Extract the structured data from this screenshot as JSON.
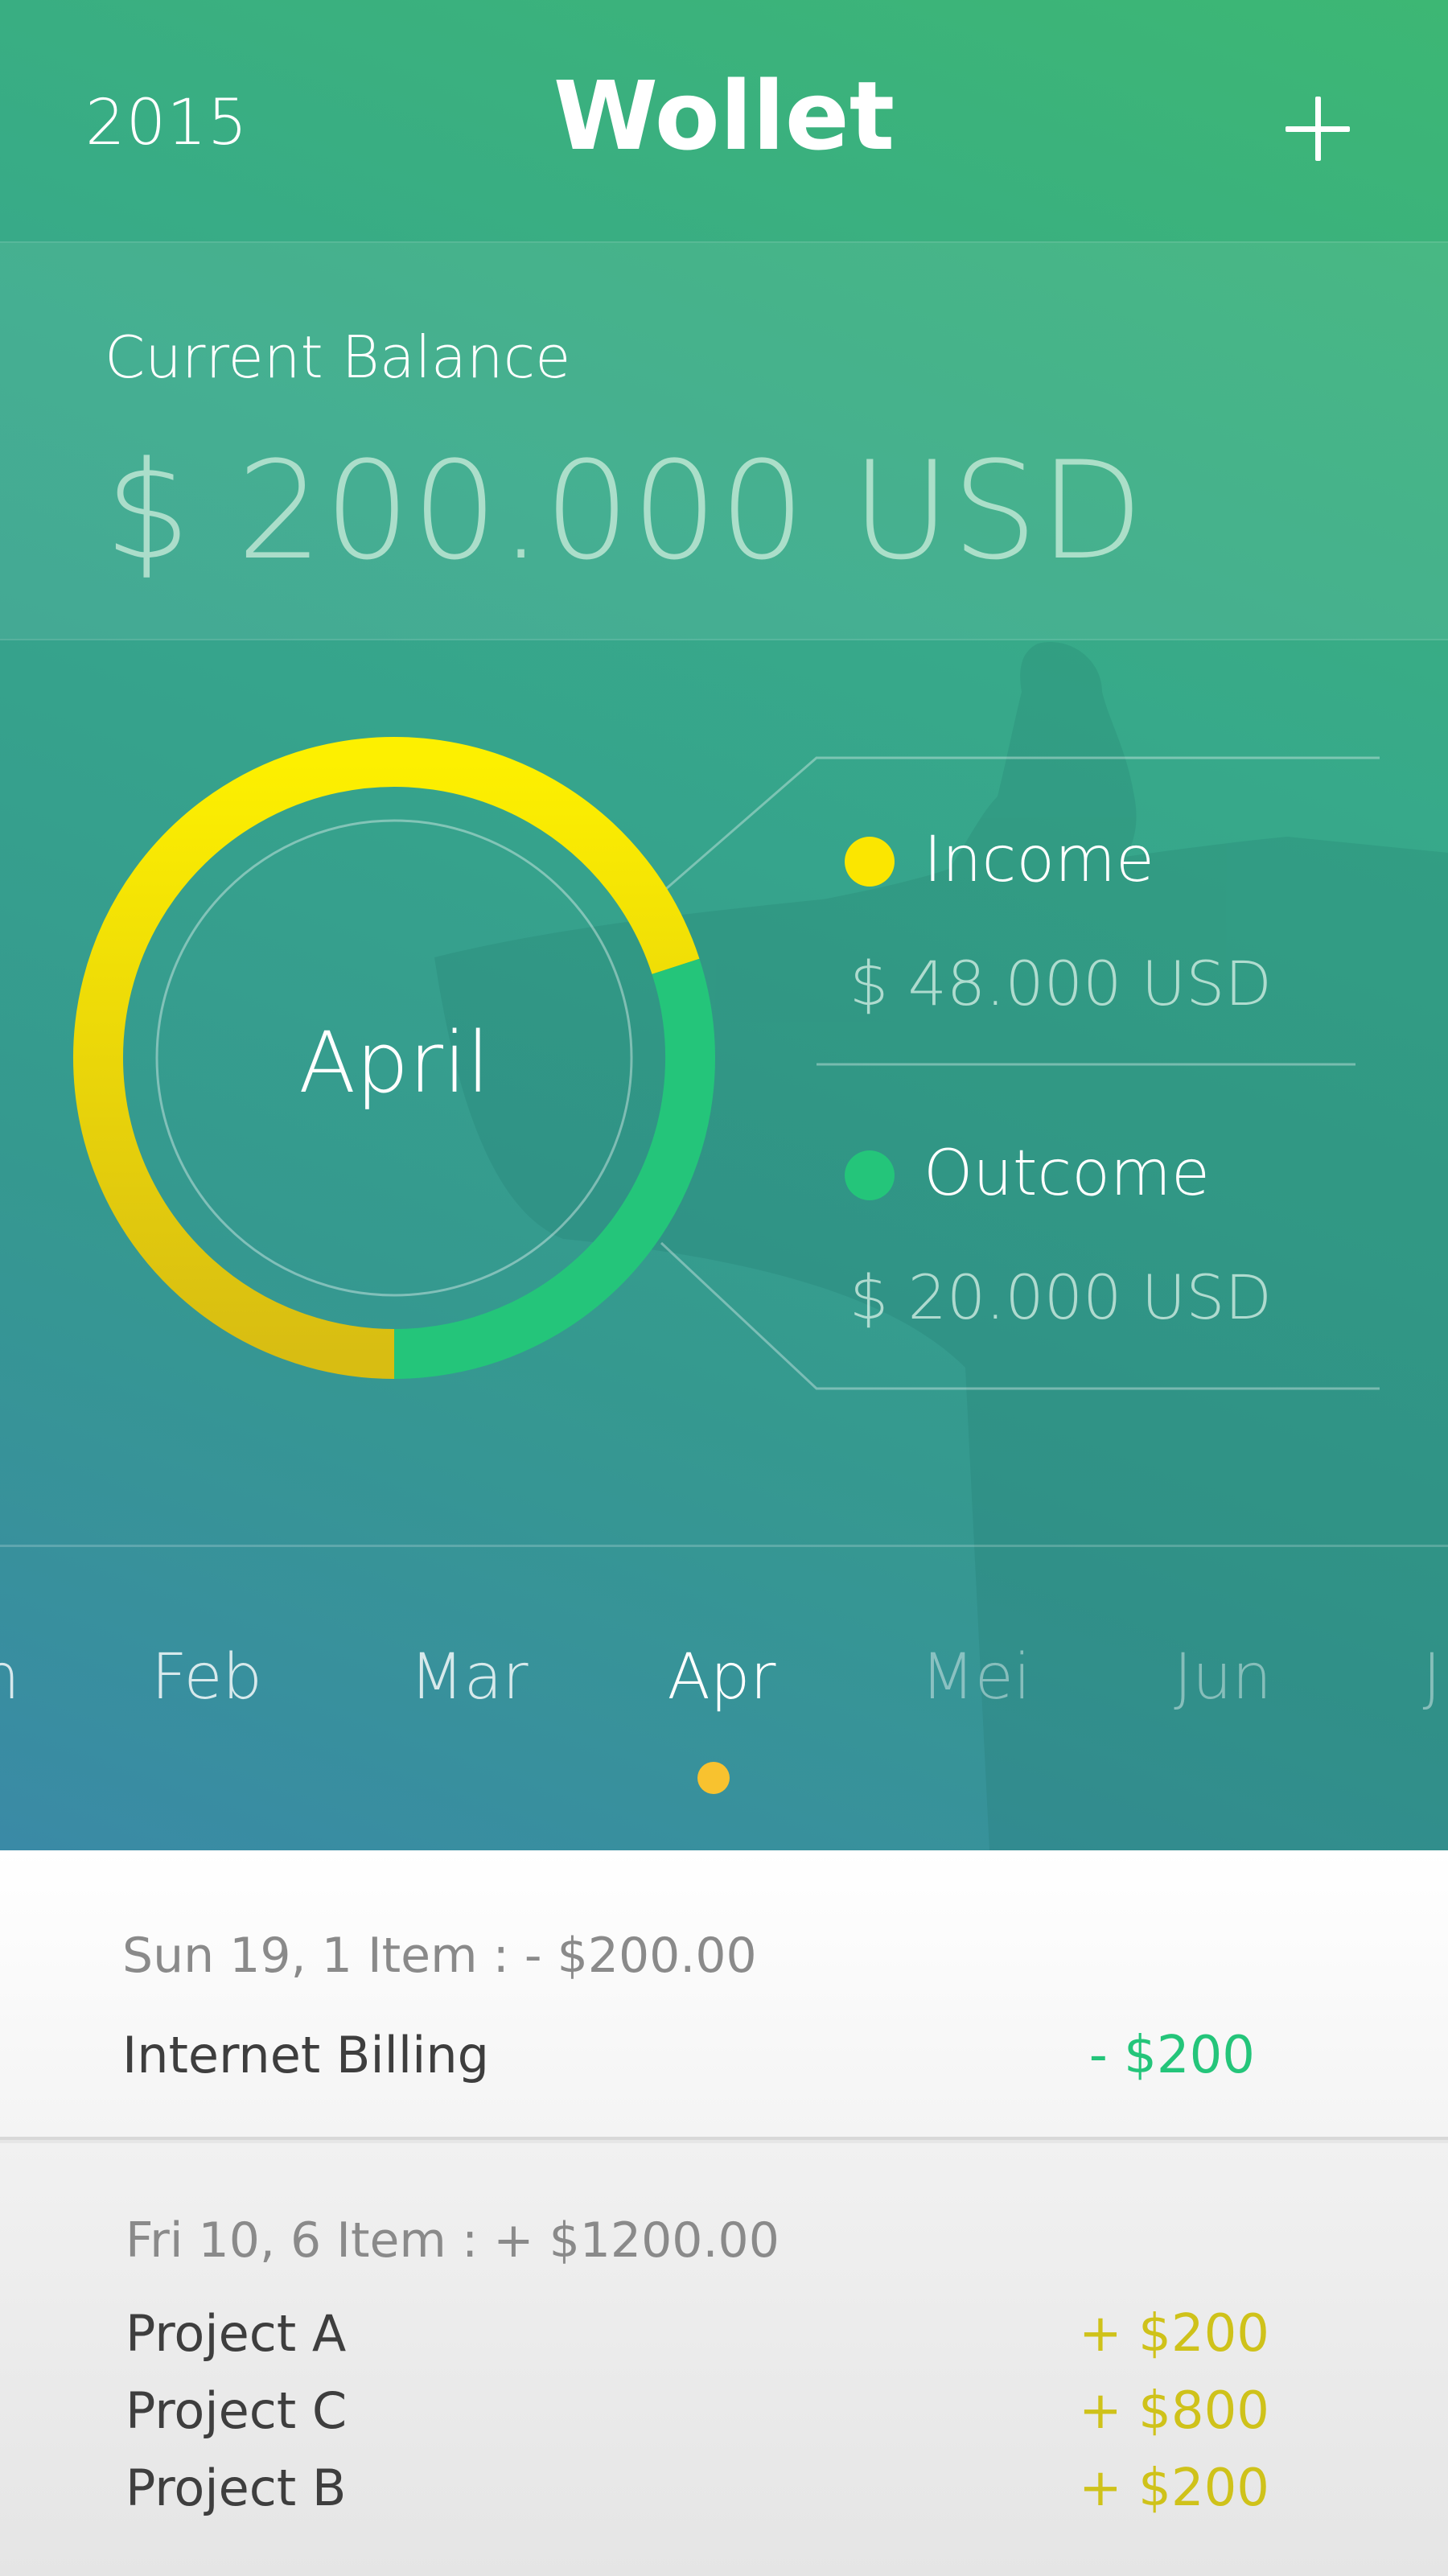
{
  "header": {
    "year": "2015",
    "title": "Wollet",
    "add_icon": "plus-icon"
  },
  "balance": {
    "label": "Current Balance",
    "value": "$ 200.000 USD"
  },
  "summary": {
    "month": "April",
    "income_share": 0.7,
    "income": {
      "label": "Income",
      "amount": "$ 48.000 USD",
      "color": "#fbe600"
    },
    "outcome": {
      "label": "Outcome",
      "amount": "$ 20.000 USD",
      "color": "#24c57a"
    }
  },
  "months": {
    "items": [
      "n",
      "Feb",
      "Mar",
      "Apr",
      "Mei",
      "Jun",
      "J"
    ],
    "selected": "Apr",
    "indicator_color": "#f8c22f"
  },
  "transactions": [
    {
      "header": "Sun 19, 1 Item : - $200.00",
      "items": [
        {
          "name": "Internet Billing",
          "amount": "- $200",
          "color": "#24c57a"
        }
      ]
    },
    {
      "header": "Fri 10, 6 Item : + $1200.00",
      "items": [
        {
          "name": "Project A",
          "amount": "+ $200",
          "color": "#cfc21a"
        },
        {
          "name": "Project C",
          "amount": "+ $800",
          "color": "#cfc21a"
        },
        {
          "name": "Project B",
          "amount": "+ $200",
          "color": "#cfc21a"
        }
      ]
    }
  ]
}
